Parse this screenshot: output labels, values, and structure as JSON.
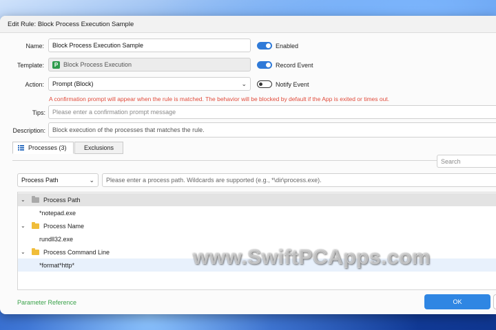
{
  "dialog": {
    "title": "Edit Rule: Block Process Execution Sample"
  },
  "form": {
    "name_label": "Name:",
    "name_value": "Block Process Execution Sample",
    "template_label": "Template:",
    "template_badge": "P",
    "template_value": "Block Process Execution",
    "action_label": "Action:",
    "action_value": "Prompt (Block)",
    "action_warning": "A confirmation prompt will appear when the rule is matched. The behavior will be blocked by default if the App is exited or times out.",
    "tips_label": "Tips:",
    "tips_placeholder": "Please enter a confirmation prompt message",
    "description_label": "Description:",
    "description_value": "Block execution of the processes that matches the rule."
  },
  "toggles": [
    {
      "label": "Enabled",
      "on": true
    },
    {
      "label": "Record Event",
      "on": true
    },
    {
      "label": "Notify Event",
      "on": false
    }
  ],
  "tabs": [
    {
      "label": "Processes (3)",
      "active": true,
      "icon": "list-icon"
    },
    {
      "label": "Exclusions",
      "active": false
    }
  ],
  "search": {
    "placeholder": "Search"
  },
  "filter": {
    "type_value": "Process Path",
    "input_placeholder": "Please enter a process path. Wildcards are supported (e.g., *\\dir\\process.exe)."
  },
  "tree": [
    {
      "type": "group",
      "label": "Process Path",
      "icon": "folder-icon"
    },
    {
      "type": "item",
      "label": "*notepad.exe"
    },
    {
      "type": "group",
      "label": "Process Name",
      "icon": "folder-icon"
    },
    {
      "type": "item",
      "label": "rundll32.exe"
    },
    {
      "type": "group",
      "label": "Process Command Line",
      "icon": "folder-icon"
    },
    {
      "type": "item",
      "label": "*format*http*"
    }
  ],
  "footer": {
    "param_link": "Parameter Reference",
    "ok_label": "OK"
  },
  "watermark": "www.SwiftPCApps.com",
  "colors": {
    "accent": "#2f86e3",
    "toggle_on": "#2f7ad8",
    "warning": "#e14b3b",
    "link": "#3aa24a",
    "template_badge": "#2e9b4c"
  }
}
